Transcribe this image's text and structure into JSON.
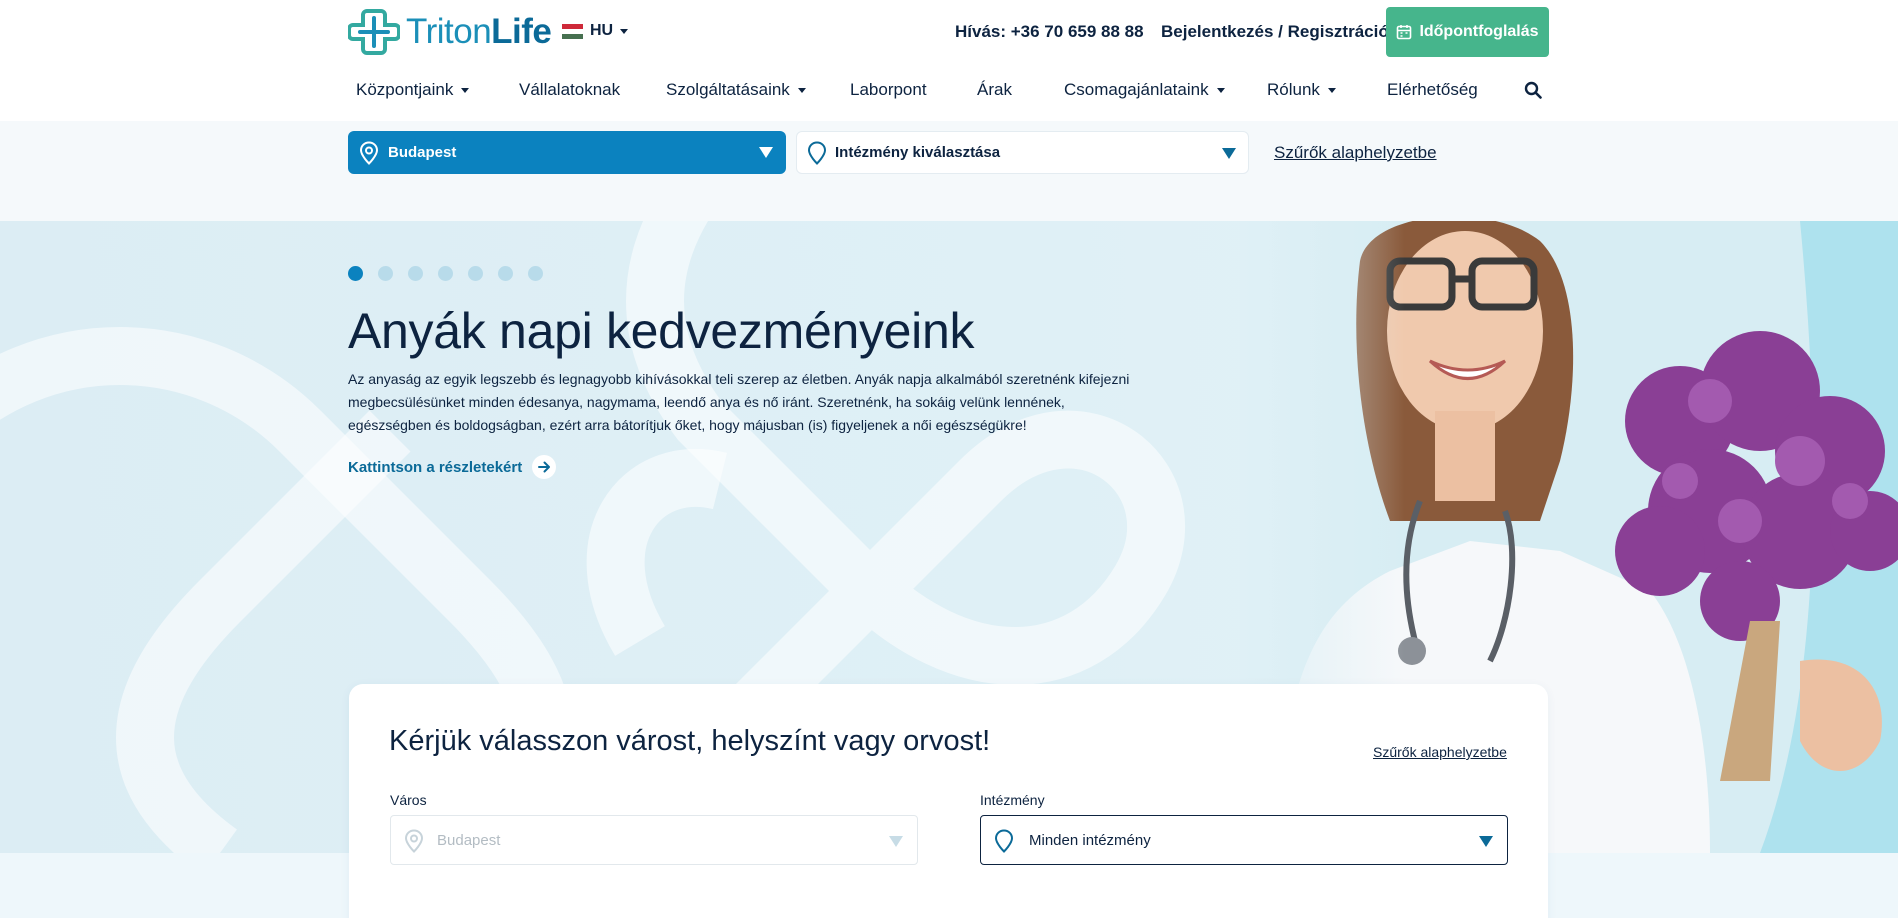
{
  "brand": {
    "name_part1": "Triton",
    "name_part2": "Life"
  },
  "language": {
    "code": "HU"
  },
  "header": {
    "phone": "Hívás: +36 70 659 88 88",
    "login": "Bejelentkezés / Regisztráció",
    "book_button": "Időpontfoglalás"
  },
  "nav": {
    "items": [
      {
        "label": "Központjaink",
        "dropdown": true
      },
      {
        "label": "Vállalatoknak",
        "dropdown": false
      },
      {
        "label": "Szolgáltatásaink",
        "dropdown": true
      },
      {
        "label": "Laborpont",
        "dropdown": false
      },
      {
        "label": "Árak",
        "dropdown": false
      },
      {
        "label": "Csomagajánlataink",
        "dropdown": true
      },
      {
        "label": "Rólunk",
        "dropdown": true
      },
      {
        "label": "Elérhetőség",
        "dropdown": false
      }
    ]
  },
  "filter_bar": {
    "city_value": "Budapest",
    "institution_value": "Intézmény kiválasztása",
    "reset": "Szűrők alaphelyzetbe"
  },
  "hero": {
    "slide_count": 7,
    "active_slide": 1,
    "title": "Anyák napi kedvezményeink",
    "text": "Az anyaság az egyik legszebb és legnagyobb kihívásokkal teli szerep az életben. Anyák napja alkalmából szeretnénk kifejezni megbecsülésünket minden édesanya, nagymama, leendő anya és nő iránt. Szeretnénk, ha sokáig velünk lennének, egészségben és boldogságban, ezért arra bátorítjuk őket, hogy májusban (is) figyeljenek a női egészségükre!",
    "link": "Kattintson a részletekért"
  },
  "search_card": {
    "title": "Kérjük válasszon várost, helyszínt vagy orvost!",
    "reset": "Szűrők alaphelyzetbe",
    "city_label": "Város",
    "city_placeholder": "Budapest",
    "institution_label": "Intézmény",
    "institution_value": "Minden intézmény"
  },
  "colors": {
    "primary": "#0b82bf",
    "accent_green": "#46b58c",
    "navy_text": "#0d2340",
    "flag": [
      "#ce2939",
      "#ffffff",
      "#477050"
    ]
  },
  "icons": [
    "logo-cross-icon",
    "calendar-icon",
    "search-icon",
    "location-pin-icon",
    "arrow-right-icon",
    "chevron-down-icon"
  ]
}
